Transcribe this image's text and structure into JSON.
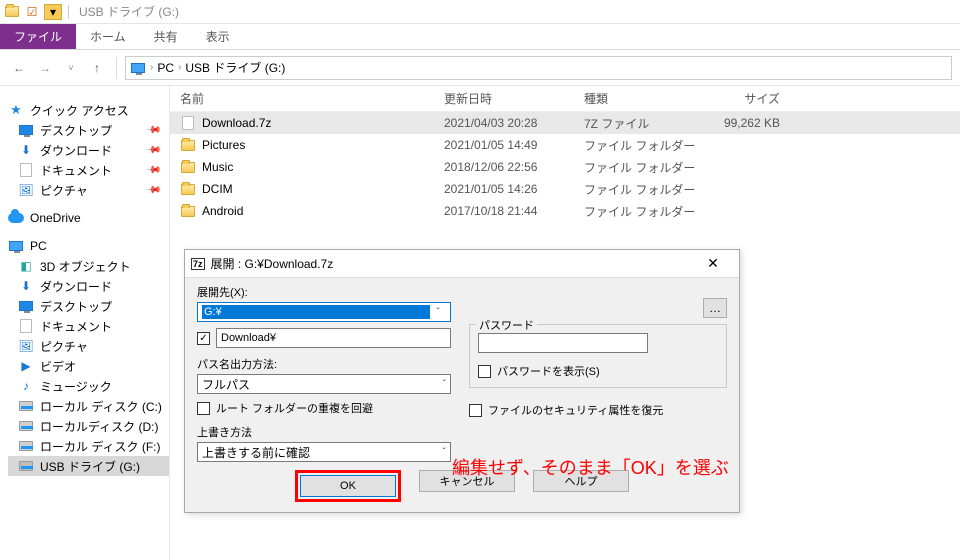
{
  "titlebar": {
    "title": "USB ドライブ (G:)"
  },
  "ribbon": {
    "tabs": {
      "active": "ファイル",
      "t1": "ホーム",
      "t2": "共有",
      "t3": "表示"
    }
  },
  "breadcrumb": {
    "b0": "PC",
    "b1": "USB ドライブ (G:)"
  },
  "nav": {
    "quick": {
      "label": "クイック アクセス",
      "i0": "デスクトップ",
      "i1": "ダウンロード",
      "i2": "ドキュメント",
      "i3": "ピクチャ"
    },
    "onedrive": "OneDrive",
    "pc": {
      "label": "PC",
      "i0": "3D オブジェクト",
      "i1": "ダウンロード",
      "i2": "デスクトップ",
      "i3": "ドキュメント",
      "i4": "ピクチャ",
      "i5": "ビデオ",
      "i6": "ミュージック",
      "i7": "ローカル ディスク (C:)",
      "i8": "ローカルディスク (D:)",
      "i9": "ローカル ディスク (F:)",
      "i10": "USB ドライブ (G:)"
    }
  },
  "columns": {
    "name": "名前",
    "date": "更新日時",
    "type": "種類",
    "size": "サイズ"
  },
  "files": {
    "r0": {
      "name": "Download.7z",
      "date": "2021/04/03 20:28",
      "type": "7Z ファイル",
      "size": "99,262 KB"
    },
    "r1": {
      "name": "Pictures",
      "date": "2021/01/05 14:49",
      "type": "ファイル フォルダー",
      "size": ""
    },
    "r2": {
      "name": "Music",
      "date": "2018/12/06 22:56",
      "type": "ファイル フォルダー",
      "size": ""
    },
    "r3": {
      "name": "DCIM",
      "date": "2021/01/05 14:26",
      "type": "ファイル フォルダー",
      "size": ""
    },
    "r4": {
      "name": "Android",
      "date": "2017/10/18 21:44",
      "type": "ファイル フォルダー",
      "size": ""
    }
  },
  "dialog": {
    "title": "展開 : G:¥Download.7z",
    "extract_to_label": "展開先(X):",
    "extract_to_value": "G:¥",
    "browse": "…",
    "subfolder_value": "Download¥",
    "path_mode_label": "パス名出力方法:",
    "path_mode_value": "フルパス",
    "eliminate_dup": "ルート フォルダーの重複を回避",
    "overwrite_label": "上書き方法",
    "overwrite_value": "上書きする前に確認",
    "password_legend": "パスワード",
    "show_password": "パスワードを表示(S)",
    "restore_security": "ファイルのセキュリティ属性を復元",
    "ok": "OK",
    "cancel": "キャンセル",
    "help": "ヘルプ"
  },
  "annotation": "編集せず、そのまま「OK」を選ぶ"
}
